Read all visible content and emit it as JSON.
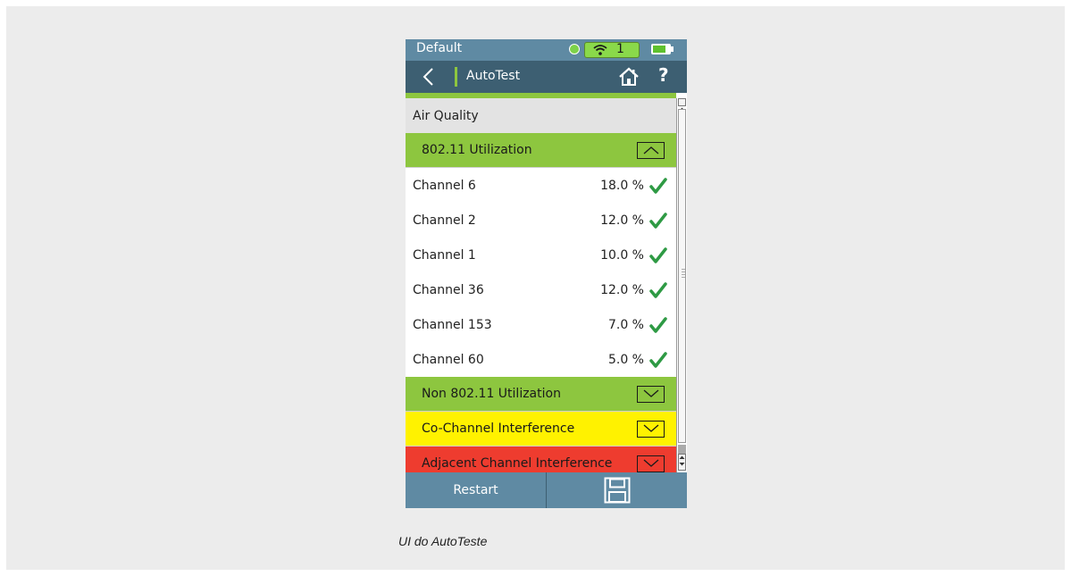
{
  "status": {
    "profile": "Default",
    "wifi_count": "1"
  },
  "header": {
    "title": "AutoTest",
    "help": "?"
  },
  "section": {
    "title": "Air Quality"
  },
  "groups": {
    "util": {
      "label": "802.11 Utilization",
      "expanded": true,
      "color": "#8dc63f"
    },
    "non_util": {
      "label": "Non 802.11 Utilization",
      "expanded": false,
      "color": "#8dc63f"
    },
    "co_channel": {
      "label": "Co-Channel Interference",
      "expanded": false,
      "color": "#fff200"
    },
    "adjacent": {
      "label": "Adjacent Channel Interference",
      "expanded": false,
      "color": "#ee3c2f"
    }
  },
  "channels": [
    {
      "name": "Channel 6",
      "value": "18.0 %"
    },
    {
      "name": "Channel 2",
      "value": "12.0 %"
    },
    {
      "name": "Channel 1",
      "value": "10.0 %"
    },
    {
      "name": "Channel 36",
      "value": "12.0 %"
    },
    {
      "name": "Channel 153",
      "value": "7.0 %"
    },
    {
      "name": "Channel 60",
      "value": "5.0 %"
    }
  ],
  "footer": {
    "restart_label": "Restart"
  },
  "caption": "UI do AutoTeste",
  "icons": {
    "back": "chevron-left-icon",
    "home": "home-icon",
    "save": "save-icon",
    "check": "check-icon",
    "wifi": "wifi-icon",
    "battery": "battery-icon"
  },
  "colors": {
    "status_bar": "#5f8aa3",
    "header": "#3d5f72",
    "accent": "#8dc63f",
    "pass": "#2e9a44"
  }
}
